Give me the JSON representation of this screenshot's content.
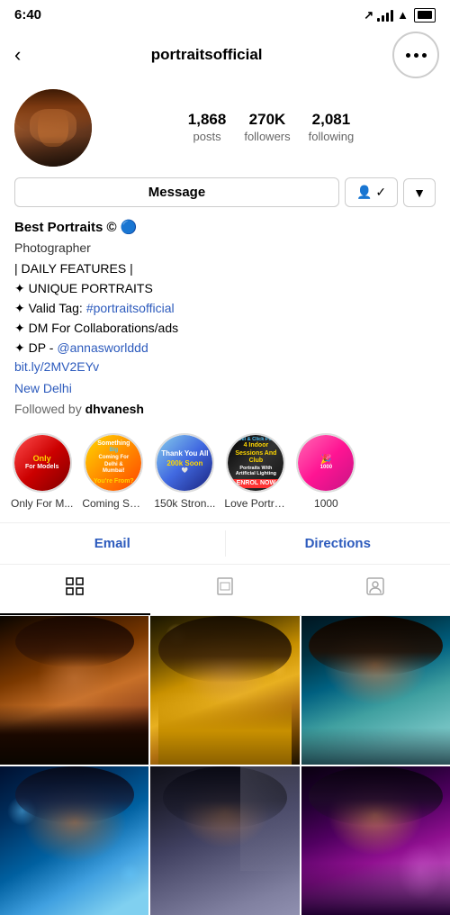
{
  "statusBar": {
    "time": "6:40",
    "arrow": "↗"
  },
  "nav": {
    "back": "‹",
    "username": "portraitsofficial",
    "moreLabel": "more options"
  },
  "profile": {
    "posts": "1,868",
    "postsLabel": "posts",
    "followers": "270K",
    "followersLabel": "followers",
    "following": "2,081",
    "followingLabel": "following",
    "messageBtn": "Message",
    "name": "Best Portraits",
    "copyright": "©",
    "title": "Photographer",
    "bioLines": [
      "| DAILY FEATURES |",
      "✦ UNIQUE PORTRAITS",
      "✦ Valid Tag: #portraitsofficial",
      "✦ DM For Collaborations/ads",
      "✦ DP - @annasworlddd"
    ],
    "link": "bit.ly/2MV2EYv",
    "location": "New Delhi",
    "followedBy": "Followed by",
    "followedByUser": "dhvanesh"
  },
  "stories": [
    {
      "id": 1,
      "label": "Only For M...",
      "bg": "story-bg-1"
    },
    {
      "id": 2,
      "label": "Coming Soon",
      "bg": "story-bg-2"
    },
    {
      "id": 3,
      "label": "150k Stron...",
      "bg": "story-bg-3"
    },
    {
      "id": 4,
      "label": "Love Portrai...",
      "bg": "story-bg-4"
    },
    {
      "id": 5,
      "label": "1000",
      "bg": "story-bg-5"
    }
  ],
  "contact": {
    "email": "Email",
    "directions": "Directions"
  },
  "tabs": [
    {
      "id": "grid",
      "label": "Grid",
      "active": true
    },
    {
      "id": "feed",
      "label": "Feed",
      "active": false
    },
    {
      "id": "tagged",
      "label": "Tagged",
      "active": false
    }
  ],
  "photos": [
    {
      "id": 1,
      "cls": "photo-1"
    },
    {
      "id": 2,
      "cls": "photo-2"
    },
    {
      "id": 3,
      "cls": "photo-3"
    },
    {
      "id": 4,
      "cls": "photo-4"
    },
    {
      "id": 5,
      "cls": "photo-5"
    },
    {
      "id": 6,
      "cls": "photo-6"
    }
  ]
}
